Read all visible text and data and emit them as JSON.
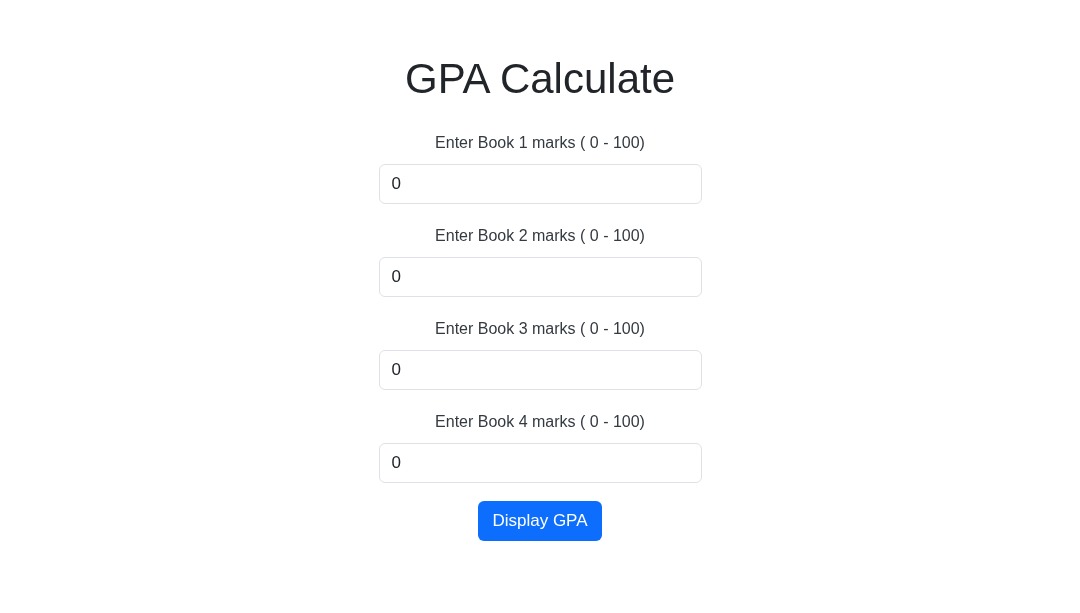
{
  "title": "GPA Calculate",
  "fields": [
    {
      "label": "Enter Book 1 marks ( 0 - 100)",
      "value": "0"
    },
    {
      "label": "Enter Book 2 marks ( 0 - 100)",
      "value": "0"
    },
    {
      "label": "Enter Book 3 marks ( 0 - 100)",
      "value": "0"
    },
    {
      "label": "Enter Book 4 marks ( 0 - 100)",
      "value": "0"
    }
  ],
  "button": {
    "label": "Display GPA"
  }
}
